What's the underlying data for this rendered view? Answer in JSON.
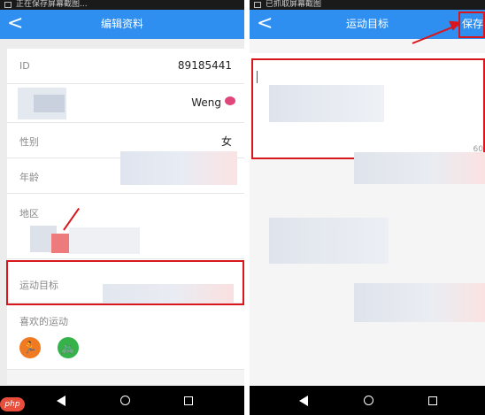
{
  "left": {
    "status_text": "正在保存屏幕截图...",
    "title": "编辑资料",
    "back_glyph": "<",
    "rows": {
      "id_label": "ID",
      "id_value": "89185441",
      "name_value": "Weng",
      "gender_label": "性别",
      "gender_value": "女",
      "age_label": "年龄",
      "region_label": "地区",
      "goal_label": "运动目标",
      "favorite_label": "喜欢的运动"
    },
    "sports": [
      {
        "icon": "running-icon",
        "color": "#f07a22"
      },
      {
        "icon": "cycling-icon",
        "color": "#36b24a"
      }
    ]
  },
  "right": {
    "status_text": "已抓取屏幕截图",
    "title": "运动目标",
    "back_glyph": "<",
    "save_label": "保存",
    "edge_text": "60"
  },
  "colors": {
    "accent": "#2f8ff0",
    "highlight": "#d9161c"
  },
  "watermark": "php"
}
